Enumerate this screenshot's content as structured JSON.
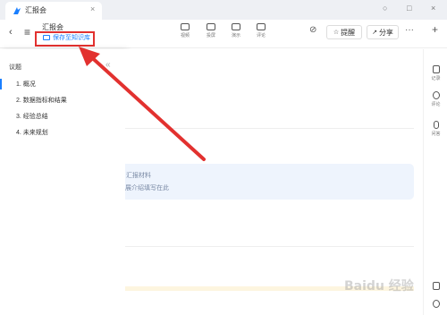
{
  "window": {
    "tab_title": "汇报会",
    "tab_close": "×",
    "controls": {
      "minimize": "○",
      "restore": "□",
      "close": "×"
    }
  },
  "toolbar": {
    "back": "‹",
    "menu": "≡",
    "doc_title": "汇报会",
    "save_to_kb": "保存至知识库",
    "tools": [
      {
        "label": "视频",
        "icon": "video-icon"
      },
      {
        "label": "投屏",
        "icon": "cast-icon"
      },
      {
        "label": "演示",
        "icon": "present-icon"
      },
      {
        "label": "评论",
        "icon": "review-icon"
      }
    ],
    "ai_icon": "⊘",
    "remind_label": "提醒",
    "share_label": "分享",
    "more": "···",
    "add": "+"
  },
  "outline": {
    "heading": "议题",
    "collapse": "«",
    "items": [
      "1. 概况",
      "2. 数据指标和结果",
      "3. 经验总结",
      "4. 未来规划"
    ]
  },
  "main": {
    "info_line1": "汇报材料",
    "info_line2": "展介绍填写在此"
  },
  "rail": {
    "items": [
      {
        "label": "记录",
        "icon": "record-icon"
      },
      {
        "label": "评论",
        "icon": "comment-icon"
      },
      {
        "label": "问答",
        "icon": "mic-icon"
      }
    ]
  },
  "watermark": "Baidu 经验",
  "colors": {
    "accent": "#1a7fff",
    "annotation": "#e2312f",
    "info_bg": "#eef4fd"
  }
}
